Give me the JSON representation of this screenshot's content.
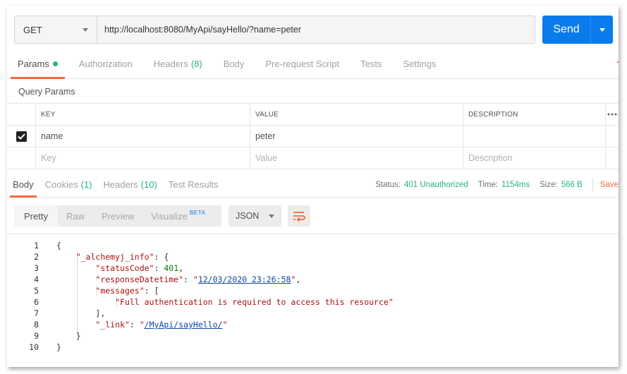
{
  "request": {
    "method": "GET",
    "url": "http://localhost:8080/MyApi/sayHello/?name=peter",
    "send_label": "Send"
  },
  "tabs": [
    {
      "label": "Params",
      "count": ""
    },
    {
      "label": "Authorization",
      "count": ""
    },
    {
      "label": "Headers",
      "count": "(8)"
    },
    {
      "label": "Body",
      "count": ""
    },
    {
      "label": "Pre-request Script",
      "count": ""
    },
    {
      "label": "Tests",
      "count": ""
    },
    {
      "label": "Settings",
      "count": ""
    }
  ],
  "query_params": {
    "title": "Query Params",
    "headers": {
      "key": "KEY",
      "value": "VALUE",
      "description": "DESCRIPTION"
    },
    "rows": [
      {
        "key": "name",
        "value": "peter",
        "description": "",
        "checked": true
      }
    ],
    "placeholders": {
      "key": "Key",
      "value": "Value",
      "description": "Description"
    }
  },
  "response_tabs": [
    {
      "label": "Body",
      "count": ""
    },
    {
      "label": "Cookies",
      "count": "(1)"
    },
    {
      "label": "Headers",
      "count": "(10)"
    },
    {
      "label": "Test Results",
      "count": ""
    }
  ],
  "response_status": {
    "status_label": "Status:",
    "status_value": "401 Unauthorized",
    "time_label": "Time:",
    "time_value": "1154ms",
    "size_label": "Size:",
    "size_value": "566 B",
    "save_label": "Save"
  },
  "format_toolbar": {
    "buttons": [
      "Pretty",
      "Raw",
      "Preview",
      "Visualize"
    ],
    "beta": "BETA",
    "language": "JSON"
  },
  "code_lines": [
    {
      "n": "1",
      "t": "{"
    },
    {
      "n": "2",
      "t": "    \"_alchemyj_info\": {"
    },
    {
      "n": "3",
      "t": "        \"statusCode\": 401,"
    },
    {
      "n": "4",
      "t": "        \"responseDatetime\": \"12/03/2020 23:26:58\","
    },
    {
      "n": "5",
      "t": "        \"messages\": ["
    },
    {
      "n": "6",
      "t": "            \"Full authentication is required to access this resource\""
    },
    {
      "n": "7",
      "t": "        ],"
    },
    {
      "n": "8",
      "t": "        \"_link\": \"/MyApi/sayHello/\""
    },
    {
      "n": "9",
      "t": "    }"
    },
    {
      "n": "10",
      "t": "}"
    }
  ],
  "colors": {
    "accent": "#f26b3a",
    "send": "#097bed",
    "success": "#26b47f"
  }
}
